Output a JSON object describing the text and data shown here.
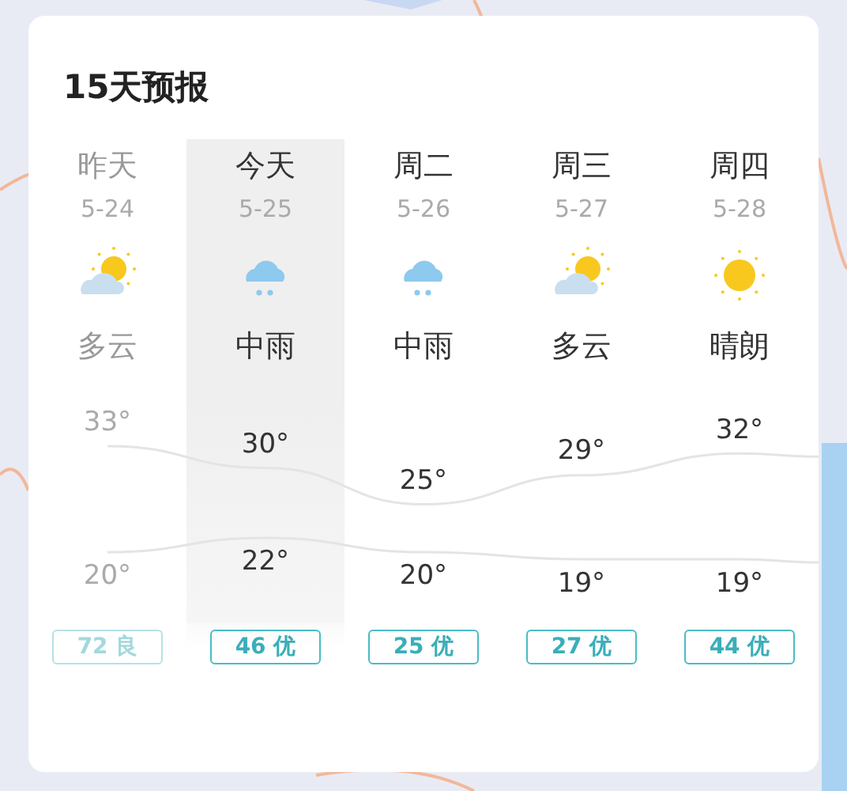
{
  "title": "15天预报",
  "days": [
    {
      "name": "昨天",
      "date": "5-24",
      "kind": "partly-cloudy",
      "condition": "多云",
      "high": "33°",
      "low": "20°",
      "aqi": "72 良",
      "past": true,
      "selected": false
    },
    {
      "name": "今天",
      "date": "5-25",
      "kind": "rain",
      "condition": "中雨",
      "high": "30°",
      "low": "22°",
      "aqi": "46 优",
      "past": false,
      "selected": true
    },
    {
      "name": "周二",
      "date": "5-26",
      "kind": "rain",
      "condition": "中雨",
      "high": "25°",
      "low": "20°",
      "aqi": "25 优",
      "past": false,
      "selected": false
    },
    {
      "name": "周三",
      "date": "5-27",
      "kind": "partly-cloudy",
      "condition": "多云",
      "high": "29°",
      "low": "19°",
      "aqi": "27 优",
      "past": false,
      "selected": false
    },
    {
      "name": "周四",
      "date": "5-28",
      "kind": "sunny",
      "condition": "晴朗",
      "high": "32°",
      "low": "19°",
      "aqi": "44 优",
      "past": false,
      "selected": false
    }
  ]
}
